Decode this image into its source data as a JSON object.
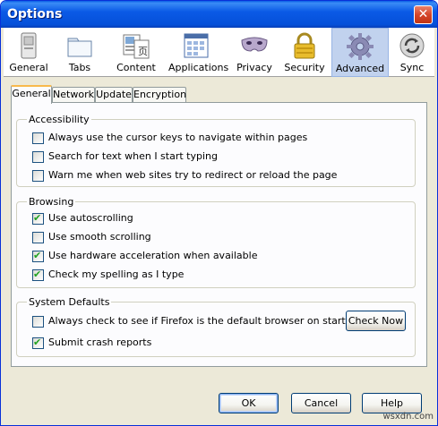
{
  "window": {
    "title": "Options",
    "close_glyph": "✕"
  },
  "toolbar": {
    "items": [
      {
        "label": "General",
        "icon": "general-icon"
      },
      {
        "label": "Tabs",
        "icon": "tabs-icon"
      },
      {
        "label": "Content",
        "icon": "content-icon"
      },
      {
        "label": "Applications",
        "icon": "applications-icon"
      },
      {
        "label": "Privacy",
        "icon": "privacy-mask-icon"
      },
      {
        "label": "Security",
        "icon": "lock-icon"
      },
      {
        "label": "Advanced",
        "icon": "gear-icon",
        "selected": true
      },
      {
        "label": "Sync",
        "icon": "sync-icon"
      }
    ]
  },
  "tabs": [
    {
      "label": "General",
      "active": true
    },
    {
      "label": "Network"
    },
    {
      "label": "Update"
    },
    {
      "label": "Encryption"
    }
  ],
  "groups": {
    "accessibility": {
      "title": "Accessibility",
      "options": [
        {
          "label": "Always use the cursor keys to navigate within pages",
          "checked": false
        },
        {
          "label": "Search for text when I start typing",
          "checked": false
        },
        {
          "label": "Warn me when web sites try to redirect or reload the page",
          "checked": false
        }
      ]
    },
    "browsing": {
      "title": "Browsing",
      "options": [
        {
          "label": "Use autoscrolling",
          "checked": true
        },
        {
          "label": "Use smooth scrolling",
          "checked": false
        },
        {
          "label": "Use hardware acceleration when available",
          "checked": true
        },
        {
          "label": "Check my spelling as I type",
          "checked": true
        }
      ]
    },
    "system_defaults": {
      "title": "System Defaults",
      "options": [
        {
          "label": "Always check to see if Firefox is the default browser on startup",
          "checked": false
        },
        {
          "label": "Submit crash reports",
          "checked": true
        }
      ],
      "check_now_label": "Check Now"
    }
  },
  "footer": {
    "ok_label": "OK",
    "cancel_label": "Cancel",
    "help_label": "Help"
  },
  "watermark": "wsxdn.com",
  "colors": {
    "titlebar": "#0550d9",
    "selected_pane": "#c1d2ee",
    "active_tab_accent": "#f8b94c",
    "checkmark": "#21a121"
  }
}
